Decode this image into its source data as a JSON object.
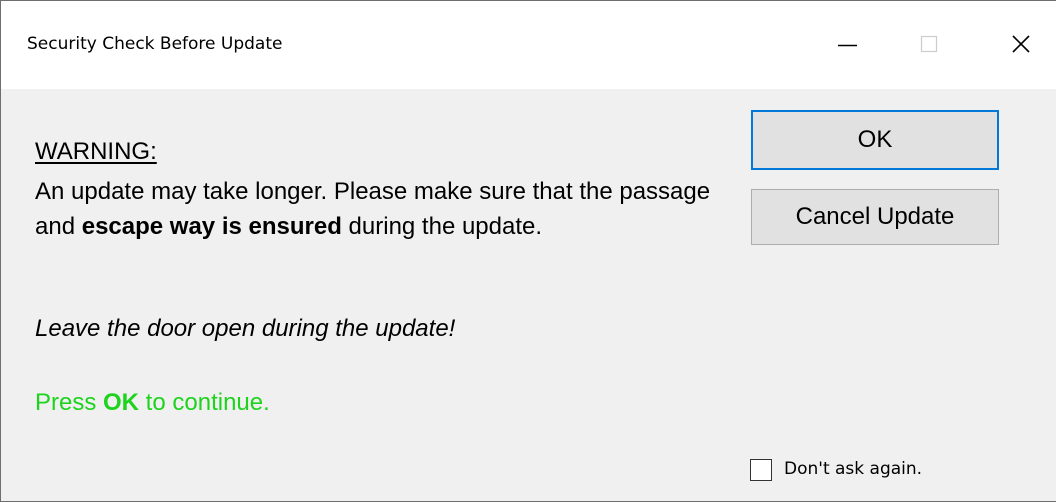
{
  "window": {
    "title": "Security Check Before Update",
    "caption_buttons": {
      "minimize_icon": "minimize-icon",
      "maximize_icon": "maximize-icon",
      "close_icon": "close-icon"
    }
  },
  "message": {
    "heading": "WARNING:",
    "body_part1": "An update may take longer. Please make sure that the passage and ",
    "body_bold": "escape way is ensured",
    "body_part2": " during the update.",
    "door_note": "Leave the door open during the update!",
    "press_prefix": "Press ",
    "press_bold": "OK",
    "press_suffix": " to continue."
  },
  "buttons": {
    "ok_label": "OK",
    "cancel_label": "Cancel Update"
  },
  "options": {
    "dont_ask_label": "Don't ask again.",
    "dont_ask_checked": false
  },
  "colors": {
    "accent": "#0078d7",
    "success_text": "#1ed31e",
    "background": "#f0f0f0"
  }
}
